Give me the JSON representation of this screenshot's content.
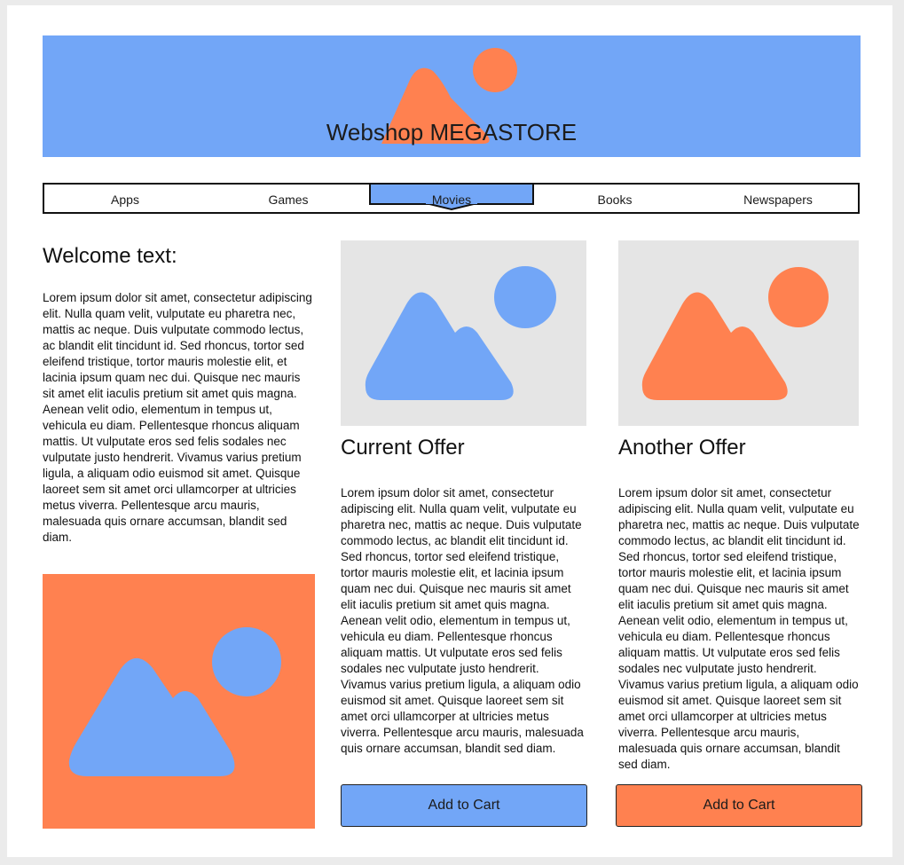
{
  "header": {
    "title": "Webshop MEGASTORE"
  },
  "nav": {
    "items": [
      {
        "label": "Apps"
      },
      {
        "label": "Games"
      },
      {
        "label": "Movies"
      },
      {
        "label": "Books"
      },
      {
        "label": "Newspapers"
      }
    ],
    "active_item": "Movies"
  },
  "welcome": {
    "title": "Welcome text:",
    "text": "Lorem ipsum dolor sit amet, consectetur adipiscing elit. Nulla quam velit, vulputate eu pharetra nec, mattis ac neque. Duis vulputate commodo lectus, ac blandit elit tincidunt id. Sed rhoncus, tortor sed eleifend tristique, tortor mauris molestie elit, et lacinia ipsum quam nec dui. Quisque nec mauris sit amet elit iaculis pretium sit amet quis magna. Aenean velit odio, elementum in tempus ut, vehicula eu diam. Pellentesque rhoncus aliquam mattis. Ut vulputate eros sed felis sodales nec vulputate justo hendrerit. Vivamus varius pretium ligula, a aliquam odio euismod sit amet. Quisque laoreet sem sit amet orci ullamcorper at ultricies metus viverra. Pellentesque arcu mauris, malesuada quis ornare accumsan, blandit sed diam."
  },
  "offers": [
    {
      "title": "Current Offer",
      "text": "Lorem ipsum dolor sit amet, consectetur adipiscing elit. Nulla quam velit, vulputate eu pharetra nec, mattis ac neque. Duis vulputate commodo lectus, ac blandit elit tincidunt id. Sed rhoncus, tortor sed eleifend tristique, tortor mauris molestie elit, et lacinia ipsum quam nec dui. Quisque nec mauris sit amet elit iaculis pretium sit amet quis magna. Aenean velit odio, elementum in tempus ut, vehicula eu diam. Pellentesque rhoncus aliquam mattis. Ut vulputate eros sed felis sodales nec vulputate justo hendrerit. Vivamus varius pretium ligula, a aliquam odio euismod sit amet. Quisque laoreet sem sit amet orci ullamcorper at ultricies metus viverra. Pellentesque arcu mauris, malesuada quis ornare accumsan, blandit sed diam.",
      "button_label": "Add to Cart",
      "button_color": "#72a6f7"
    },
    {
      "title": "Another Offer",
      "text": "Lorem ipsum dolor sit amet, consectetur adipiscing elit. Nulla quam velit, vulputate eu pharetra nec, mattis ac neque. Duis vulputate commodo lectus, ac blandit elit tincidunt id. Sed rhoncus, tortor sed eleifend tristique, tortor mauris molestie elit, et lacinia ipsum quam nec dui. Quisque nec mauris sit amet elit iaculis pretium sit amet quis magna. Aenean velit odio, elementum in tempus ut, vehicula eu diam. Pellentesque rhoncus aliquam mattis. Ut vulputate eros sed felis sodales nec vulputate justo hendrerit. Vivamus varius pretium ligula, a aliquam odio euismod sit amet. Quisque laoreet sem sit amet orci ullamcorper at ultricies metus viverra. Pellentesque arcu mauris, malesuada quis ornare accumsan, blandit sed diam.",
      "button_label": "Add to Cart",
      "button_color": "#ff8150"
    }
  ],
  "colors": {
    "blue": "#72a6f7",
    "orange": "#ff8150",
    "placeholder_bg": "#e5e5e5"
  },
  "icons": {
    "image_placeholder": "mountain-sun-image-icon"
  }
}
